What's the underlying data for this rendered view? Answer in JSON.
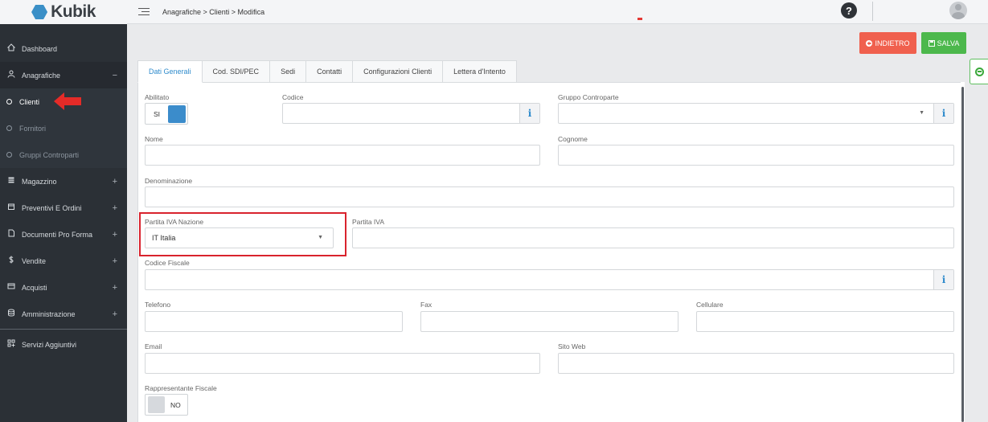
{
  "brand": {
    "name": "Kubik"
  },
  "breadcrumb": "Anagrafiche > Clienti > Modifica",
  "sidebar": {
    "dashboard": "Dashboard",
    "anagrafiche": "Anagrafiche",
    "anagrafiche_toggle": "−",
    "sub": [
      "Clienti",
      "Fornitori",
      "Gruppi Controparti"
    ],
    "items": [
      {
        "label": "Magazzino",
        "toggle": "+"
      },
      {
        "label": "Preventivi E Ordini",
        "toggle": "+"
      },
      {
        "label": "Documenti Pro Forma",
        "toggle": "+"
      },
      {
        "label": "Vendite",
        "toggle": "+"
      },
      {
        "label": "Acquisti",
        "toggle": "+"
      },
      {
        "label": "Amministrazione",
        "toggle": "+"
      }
    ],
    "servizi": "Servizi Aggiuntivi"
  },
  "actions": {
    "back": "INDIETRO",
    "save": "SALVA"
  },
  "tabs": [
    "Dati Generali",
    "Cod. SDI/PEC",
    "Sedi",
    "Contatti",
    "Configurazioni Clienti",
    "Lettera d'Intento"
  ],
  "form": {
    "abilitato": {
      "label": "Abilitato",
      "value": "SI"
    },
    "codice": {
      "label": "Codice",
      "value": ""
    },
    "gruppo": {
      "label": "Gruppo Controparte",
      "value": ""
    },
    "nome": {
      "label": "Nome",
      "value": ""
    },
    "cognome": {
      "label": "Cognome",
      "value": ""
    },
    "denominazione": {
      "label": "Denominazione",
      "value": ""
    },
    "piva_nazione": {
      "label": "Partita IVA Nazione",
      "value": "IT Italia"
    },
    "piva": {
      "label": "Partita IVA",
      "value": ""
    },
    "codice_fiscale": {
      "label": "Codice Fiscale",
      "value": ""
    },
    "telefono": {
      "label": "Telefono",
      "value": ""
    },
    "fax": {
      "label": "Fax",
      "value": ""
    },
    "cellulare": {
      "label": "Cellulare",
      "value": ""
    },
    "email": {
      "label": "Email",
      "value": ""
    },
    "sito_web": {
      "label": "Sito Web",
      "value": ""
    },
    "rappresentante": {
      "label": "Rappresentante Fiscale",
      "value": "NO"
    }
  },
  "glyphs": {
    "info": "i",
    "caret": "▼",
    "help": "?"
  },
  "colors": {
    "accent": "#2f8bcc",
    "back": "#f0604e",
    "save": "#4cb84c",
    "sidebar": "#2b3036",
    "highlight": "#d9232d"
  },
  "icons": [
    "dashboard-icon",
    "user-icon",
    "warehouse-icon",
    "order-icon",
    "document-icon",
    "dollar-icon",
    "card-icon",
    "database-icon",
    "services-icon",
    "help-icon",
    "avatar-icon",
    "arrow-left-icon",
    "save-icon",
    "info-icon"
  ]
}
